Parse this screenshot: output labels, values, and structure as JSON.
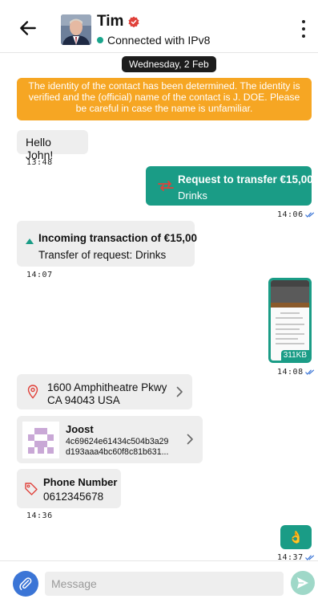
{
  "header": {
    "contact_name": "Tim",
    "connection_status": "Connected with IPv8"
  },
  "chat": {
    "date_separator": "Wednesday, 2 Feb",
    "identity_notice": "The identity of the contact has been determined. The identity is verified and the (official) name of the contact is J. DOE. Please be careful in case the name is unfamiliar.",
    "messages": [
      {
        "type": "text",
        "direction": "incoming",
        "text": "Hello John!",
        "time": "13:48"
      },
      {
        "type": "transfer_request",
        "direction": "outgoing",
        "title": "Request to transfer €15,00",
        "subtitle": "Drinks",
        "time": "14:06",
        "read": true
      },
      {
        "type": "incoming_transaction",
        "direction": "incoming",
        "title": "Incoming transaction of €15,00",
        "subtitle": "Transfer of request: Drinks",
        "time": "14:07"
      },
      {
        "type": "image",
        "direction": "outgoing",
        "size_label": "311KB",
        "time": "14:08",
        "read": true
      },
      {
        "type": "location",
        "direction": "incoming",
        "line1": "1600 Amphitheatre Pkwy",
        "line2": "CA 94043 USA"
      },
      {
        "type": "contact",
        "direction": "incoming",
        "name": "Joost",
        "key_line1": "4c69624e61434c504b3a29",
        "key_line2": "d193aaa4bc60f8c81b631..."
      },
      {
        "type": "identity_attribute",
        "direction": "incoming",
        "label": "Phone Number",
        "value": "0612345678",
        "time": "14:36"
      },
      {
        "type": "emoji",
        "direction": "outgoing",
        "emoji": "👌",
        "time": "14:37",
        "read": true
      }
    ]
  },
  "composer": {
    "placeholder": "Message"
  },
  "colors": {
    "accent_green": "#1a9c86",
    "notice_orange": "#f6a623",
    "attach_blue": "#3b75d6",
    "incoming_bubble": "#eeeeee",
    "status_dot": "#1aa58c"
  },
  "icons": {
    "back": "arrow-left-icon",
    "verified": "verified-badge-icon",
    "more": "more-vertical-icon",
    "transfer": "euro-transfer-icon",
    "incoming": "arrow-up-triangle-icon",
    "location": "location-pin-icon",
    "chevron": "chevron-right-icon",
    "tag": "tag-icon",
    "attach": "paperclip-icon",
    "send": "send-icon",
    "read": "double-check-icon"
  }
}
